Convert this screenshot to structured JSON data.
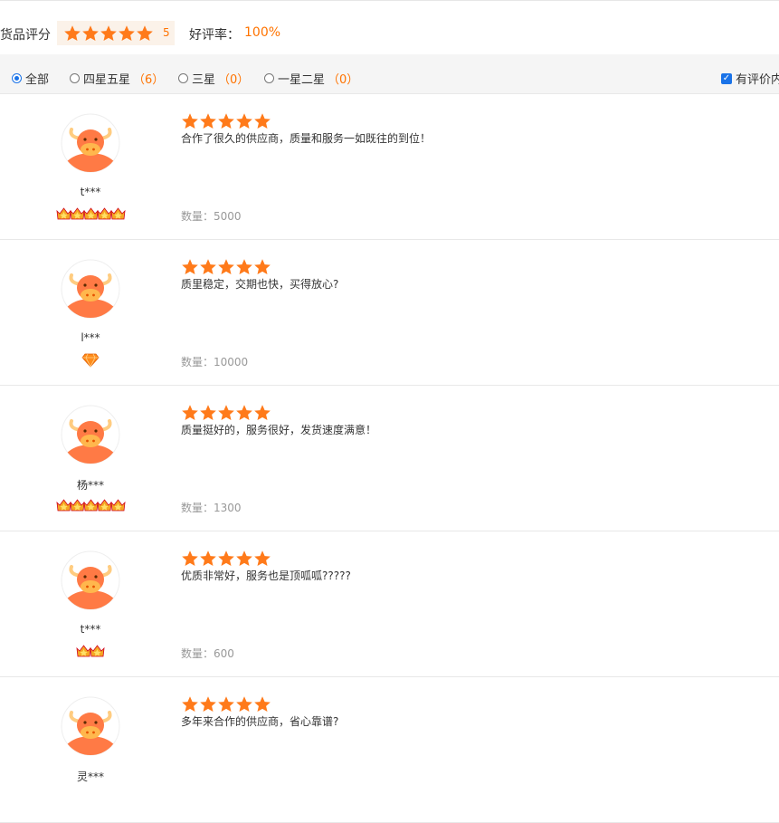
{
  "header": {
    "score_label": "货品评分",
    "score_value": "5",
    "score_stars": 5,
    "rate_label": "好评率：",
    "rate_value": "100%"
  },
  "filters": {
    "options": [
      {
        "label": "全部",
        "count": "",
        "selected": true
      },
      {
        "label": "四星五星",
        "count": "（6）",
        "selected": false
      },
      {
        "label": "三星",
        "count": "（0）",
        "selected": false
      },
      {
        "label": "一星二星",
        "count": "（0）",
        "selected": false
      }
    ],
    "has_content_label": "有评价内容",
    "has_content_checked": true
  },
  "colors": {
    "accent": "#ff7300",
    "star": "#ff7a1a",
    "radio_checked": "#1a73e8"
  },
  "reviews": [
    {
      "user": "t***",
      "stars": 5,
      "content": "合作了很久的供应商，质量和服务一如既往的到位！",
      "quantity": "数量：5000",
      "badge_type": "crown",
      "badge_count": 5
    },
    {
      "user": "l***",
      "stars": 5,
      "content": "质里稳定，交期也快，买得放心?",
      "quantity": "数量：10000",
      "badge_type": "diamond",
      "badge_count": 1
    },
    {
      "user": "杨***",
      "stars": 5,
      "content": "质量挺好的，服务很好，发货速度满意！",
      "quantity": "数量：1300",
      "badge_type": "crown",
      "badge_count": 5
    },
    {
      "user": "t***",
      "stars": 5,
      "content": "优质非常好，服务也是顶呱呱?????",
      "quantity": "数量：600",
      "badge_type": "crown",
      "badge_count": 2
    },
    {
      "user": "灵***",
      "stars": 5,
      "content": "多年来合作的供应商，省心靠谱?",
      "quantity": "",
      "badge_type": "crown",
      "badge_count": 0
    }
  ]
}
